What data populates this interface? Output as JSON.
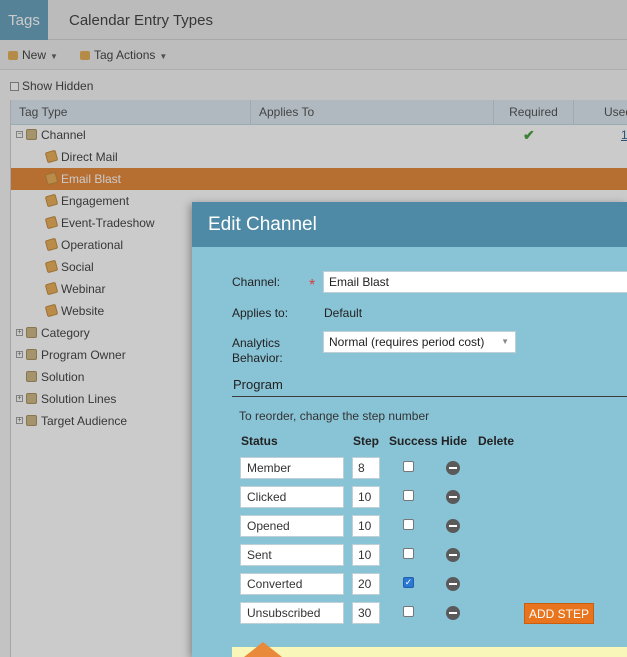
{
  "tabs": {
    "active": "Tags",
    "other": "Calendar Entry Types"
  },
  "toolbar": {
    "new_label": "New",
    "actions_label": "Tag Actions"
  },
  "show_hidden_label": "Show Hidden",
  "grid": {
    "columns": [
      "Tag Type",
      "Applies To",
      "Required",
      "Used"
    ],
    "rows": [
      {
        "label": "Channel",
        "level": 0,
        "expander": "−",
        "icon": "folder",
        "required": true,
        "used": "1"
      },
      {
        "label": "Direct Mail",
        "level": 1,
        "icon": "tag"
      },
      {
        "label": "Email Blast",
        "level": 1,
        "icon": "tag",
        "selected": true
      },
      {
        "label": "Engagement",
        "level": 1,
        "icon": "tag"
      },
      {
        "label": "Event-Tradeshow",
        "level": 1,
        "icon": "tag"
      },
      {
        "label": "Operational",
        "level": 1,
        "icon": "tag"
      },
      {
        "label": "Social",
        "level": 1,
        "icon": "tag"
      },
      {
        "label": "Webinar",
        "level": 1,
        "icon": "tag"
      },
      {
        "label": "Website",
        "level": 1,
        "icon": "tag"
      },
      {
        "label": "Category",
        "level": 0,
        "expander": "+",
        "icon": "folder"
      },
      {
        "label": "Program Owner",
        "level": 0,
        "expander": "+",
        "icon": "folder"
      },
      {
        "label": "Solution",
        "level": 0,
        "icon": "folder"
      },
      {
        "label": "Solution Lines",
        "level": 0,
        "expander": "+",
        "icon": "folder"
      },
      {
        "label": "Target Audience",
        "level": 0,
        "expander": "+",
        "icon": "folder"
      }
    ]
  },
  "dialog": {
    "title": "Edit Channel",
    "channel_label": "Channel:",
    "channel_value": "Email Blast",
    "applies_label": "Applies to:",
    "applies_value": "Default",
    "analytics_label_1": "Analytics",
    "analytics_label_2": "Behavior:",
    "analytics_value": "Normal (requires period cost)",
    "section_title": "Program",
    "hint": "To reorder, change the step number",
    "columns": {
      "status": "Status",
      "step": "Step",
      "success": "Success",
      "hide": "Hide",
      "delete": "Delete"
    },
    "statuses": [
      {
        "name": "Member",
        "step": "8",
        "success": false
      },
      {
        "name": "Clicked",
        "step": "10",
        "success": false
      },
      {
        "name": "Opened",
        "step": "10",
        "success": false
      },
      {
        "name": "Sent",
        "step": "10",
        "success": false
      },
      {
        "name": "Converted",
        "step": "20",
        "success": true
      },
      {
        "name": "Unsubscribed",
        "step": "30",
        "success": false
      }
    ],
    "add_step_label": "ADD STEP"
  },
  "colors": {
    "accent": "#e8741e",
    "dialog_header": "#4e8aa6",
    "dialog_body": "#89c3d6",
    "selected_row": "#e27f2a"
  }
}
